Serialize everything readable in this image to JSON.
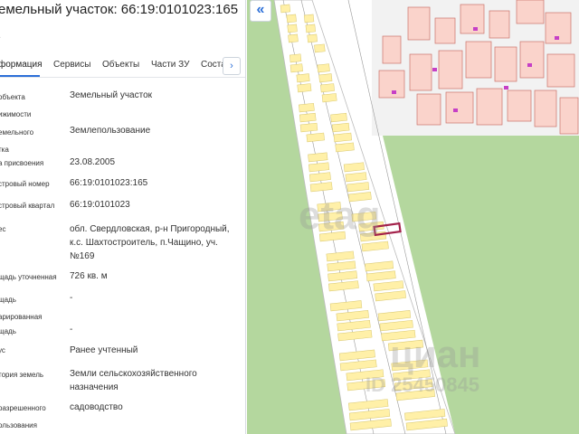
{
  "header": {
    "title": "емельный участок: 66:19:0101023:165",
    "dot": "·"
  },
  "tabs": [
    {
      "label": "формация",
      "active": true
    },
    {
      "label": "Сервисы",
      "active": false
    },
    {
      "label": "Объекты",
      "active": false
    },
    {
      "label": "Части ЗУ",
      "active": false
    },
    {
      "label": "Соста",
      "active": false
    }
  ],
  "tab_next": "›",
  "collapse_icon": "«",
  "rows": [
    {
      "label": "объекта\nижимости",
      "value": "Земельный участок"
    },
    {
      "label": "емельного\nтка",
      "value": "Землепользование"
    },
    {
      "label": "а присвоения",
      "value": "23.08.2005"
    },
    {
      "label": "стровый номер",
      "value": "66:19:0101023:165"
    },
    {
      "label": "стровый квартал",
      "value": "66:19:0101023"
    },
    {
      "label": "ес",
      "value": "обл. Свердловская, р-н Пригородный, к.с. Шахтостроитель, п.Чащино, уч.№169"
    },
    {
      "label": "щадь уточненная",
      "value": "726 кв. м"
    },
    {
      "label": "щадь\nарированная",
      "value": "-"
    },
    {
      "label": "щадь",
      "value": "-"
    },
    {
      "label": "ус",
      "value": "Ранее учтенный"
    },
    {
      "label": "тория земель",
      "value": "Земли сельскохозяйственного назначения"
    },
    {
      "label": "разрешенного\nользования",
      "value": "садоводство"
    }
  ],
  "map": {
    "watermark_left": "etag",
    "watermark_brand": "циан",
    "watermark_id": "ID 25450845",
    "colors": {
      "green": "#b4d79e",
      "parcel": "#fff0a8",
      "parcel_border": "#d9c870",
      "building": "#fad3cb",
      "building_border": "#c9736a",
      "highlight": "#a3224b",
      "marker": "#c63fc6"
    }
  }
}
